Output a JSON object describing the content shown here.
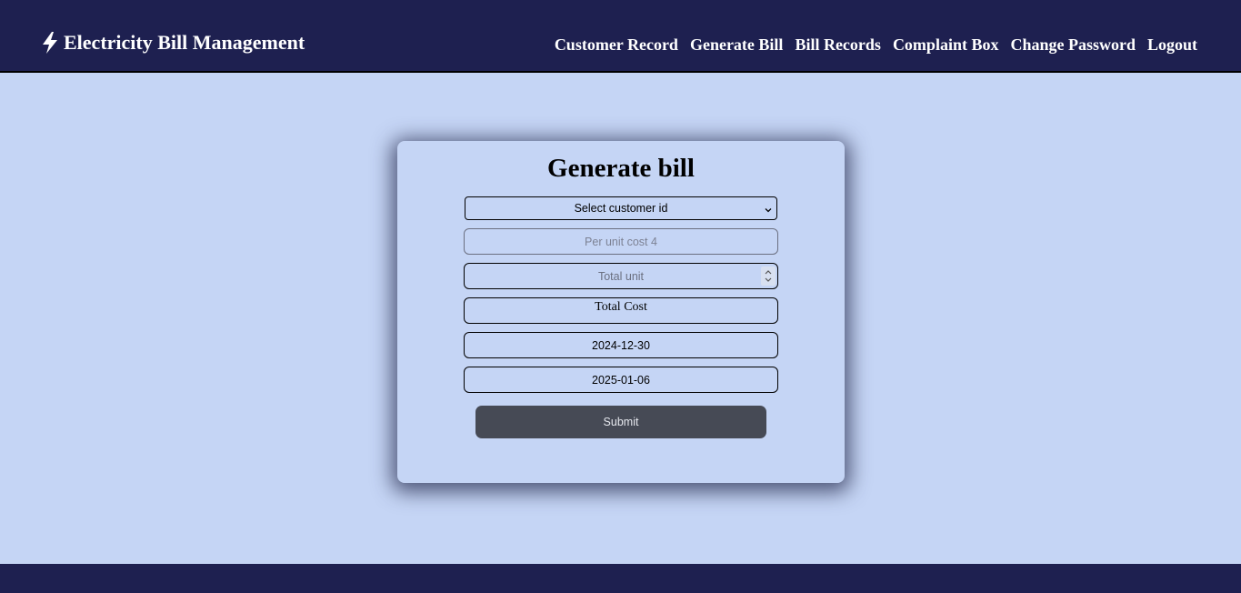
{
  "header": {
    "brand_icon": "lightning-bolt-icon",
    "brand_title": "Electricity Bill Management",
    "nav": [
      {
        "label": "Customer Record"
      },
      {
        "label": "Generate Bill"
      },
      {
        "label": "Bill Records"
      },
      {
        "label": "Complaint Box"
      },
      {
        "label": "Change Password"
      },
      {
        "label": "Logout"
      }
    ]
  },
  "form": {
    "title": "Generate bill",
    "customer_select": {
      "selected": "Select customer id",
      "icon": "chevron-down-icon"
    },
    "per_unit_cost": {
      "placeholder": "Per unit cost 4",
      "disabled": true
    },
    "total_unit": {
      "placeholder": "Total unit"
    },
    "total_cost": {
      "value": "Total Cost"
    },
    "bill_date": {
      "value": "2024-12-30"
    },
    "due_date": {
      "value": "2025-01-06"
    },
    "submit_label": "Submit"
  },
  "colors": {
    "navbar": "#1e2050",
    "page_background": "#c5d5f5",
    "button": "#464a55"
  }
}
